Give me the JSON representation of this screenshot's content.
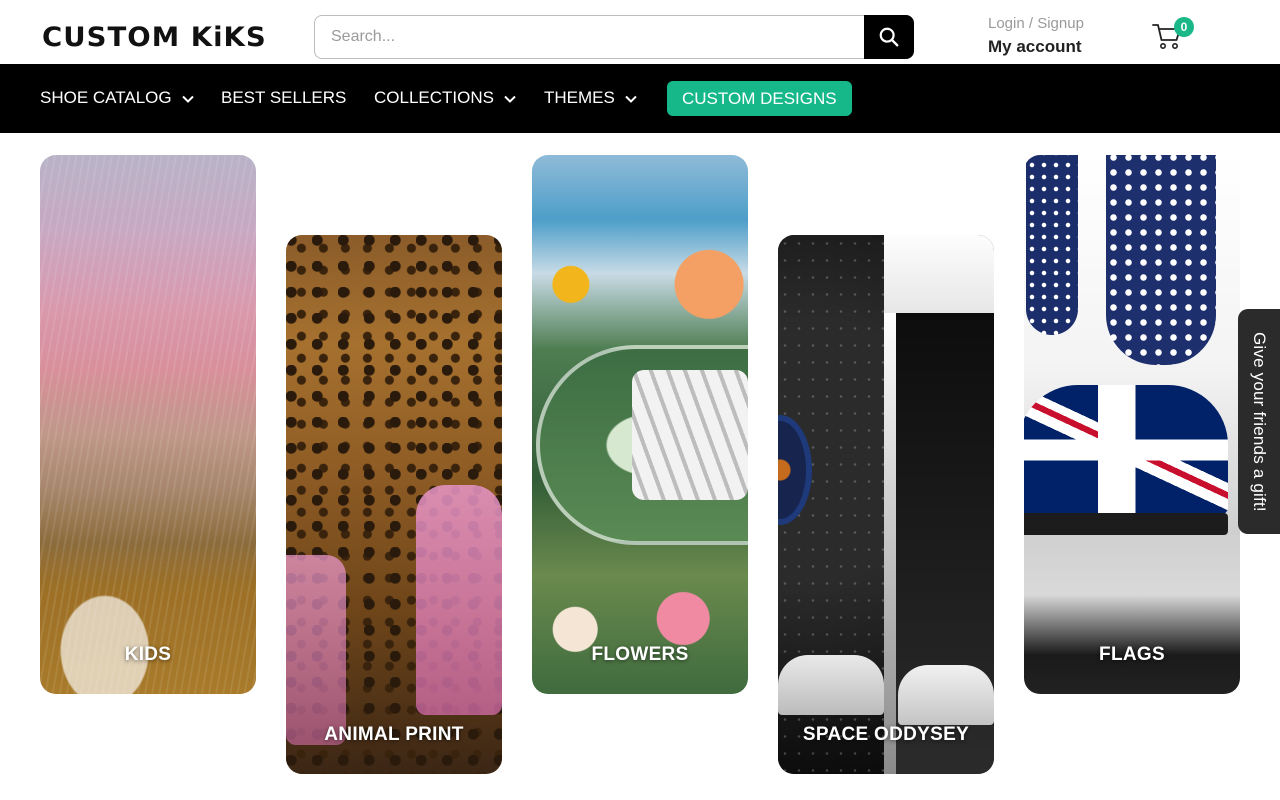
{
  "brand": {
    "logo_text": "CUSTOM KiKS"
  },
  "search": {
    "placeholder": "Search..."
  },
  "account": {
    "login_label": "Login / Signup",
    "my_account_label": "My account"
  },
  "cart": {
    "count": "0",
    "accent_color": "#1ab789"
  },
  "nav": {
    "items": [
      {
        "label": "SHOE CATALOG",
        "has_dropdown": true
      },
      {
        "label": "BEST SELLERS",
        "has_dropdown": false
      },
      {
        "label": "COLLECTIONS",
        "has_dropdown": true
      },
      {
        "label": "THEMES",
        "has_dropdown": true
      }
    ],
    "cta_label": "CUSTOM DESIGNS",
    "cta_color": "#16b88a"
  },
  "categories": [
    {
      "label": "KIDS"
    },
    {
      "label": "ANIMAL PRINT"
    },
    {
      "label": "FLOWERS"
    },
    {
      "label": "SPACE ODDYSEY"
    },
    {
      "label": "FLAGS"
    }
  ],
  "gift_tab": {
    "label": "Give your friends a gift!"
  },
  "icons": {
    "search": "search-icon",
    "cart": "cart-icon",
    "dropdown": "chevron-down-icon"
  }
}
